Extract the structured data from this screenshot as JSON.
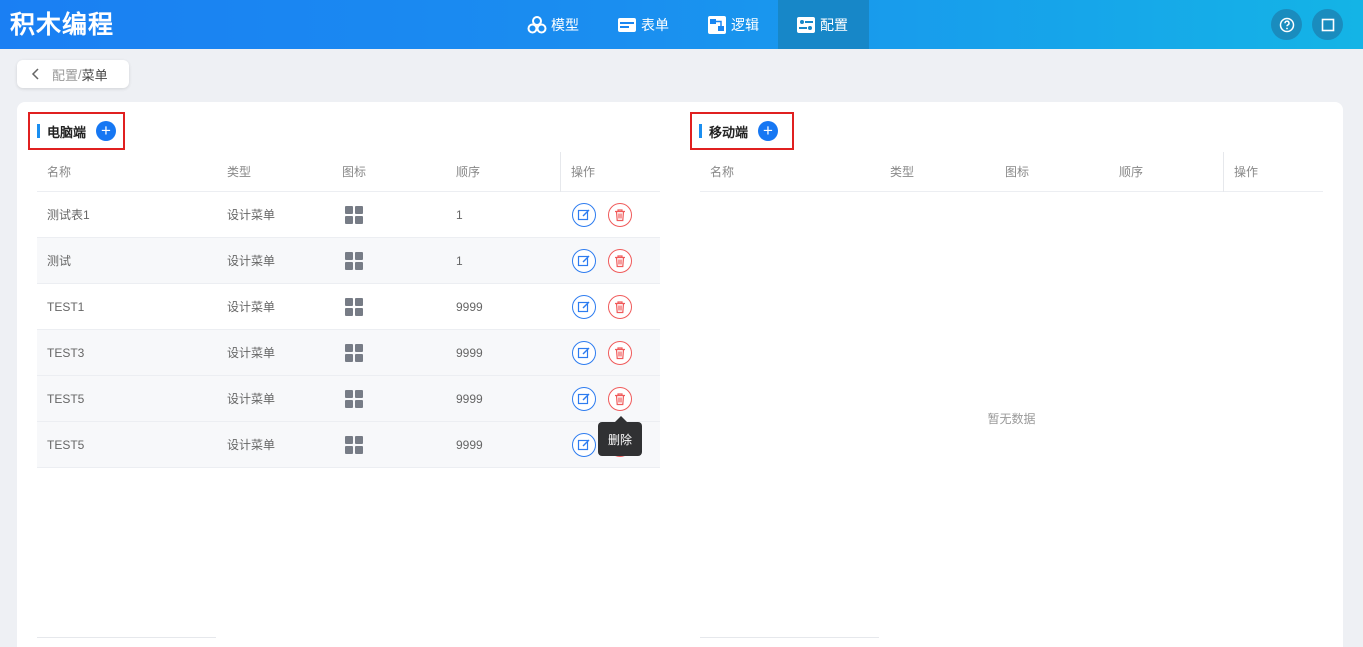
{
  "app": {
    "title": "积木编程"
  },
  "nav": [
    {
      "label": "模型",
      "icon": "cubes-icon",
      "active": false
    },
    {
      "label": "表单",
      "icon": "form-icon",
      "active": false
    },
    {
      "label": "逻辑",
      "icon": "logic-icon",
      "active": false
    },
    {
      "label": "配置",
      "icon": "config-icon",
      "active": true
    }
  ],
  "header_actions": [
    {
      "icon": "help-icon"
    },
    {
      "icon": "fullscreen-icon"
    }
  ],
  "breadcrumb": {
    "parent": "配置",
    "separator": "/",
    "current": "菜单"
  },
  "desktop": {
    "title": "电脑端",
    "columns": {
      "name": "名称",
      "type": "类型",
      "icon": "图标",
      "order": "顺序",
      "ops": "操作"
    },
    "rows": [
      {
        "name": "测试表1",
        "type": "设计菜单",
        "icon": "grid-icon",
        "order": "1"
      },
      {
        "name": "测试",
        "type": "设计菜单",
        "icon": "grid-icon",
        "order": "1"
      },
      {
        "name": "TEST1",
        "type": "设计菜单",
        "icon": "grid-icon",
        "order": "9999"
      },
      {
        "name": "TEST3",
        "type": "设计菜单",
        "icon": "grid-icon",
        "order": "9999"
      },
      {
        "name": "TEST5",
        "type": "设计菜单",
        "icon": "grid-icon",
        "order": "9999"
      },
      {
        "name": "TEST5",
        "type": "设计菜单",
        "icon": "grid-icon",
        "order": "9999"
      }
    ],
    "tooltip": "删除"
  },
  "mobile": {
    "title": "移动端",
    "columns": {
      "name": "名称",
      "type": "类型",
      "icon": "图标",
      "order": "顺序",
      "ops": "操作"
    },
    "empty_text": "暂无数据"
  },
  "colors": {
    "accent": "#1677f3",
    "danger": "#f05a5a",
    "highlight_border": "#e02020"
  }
}
